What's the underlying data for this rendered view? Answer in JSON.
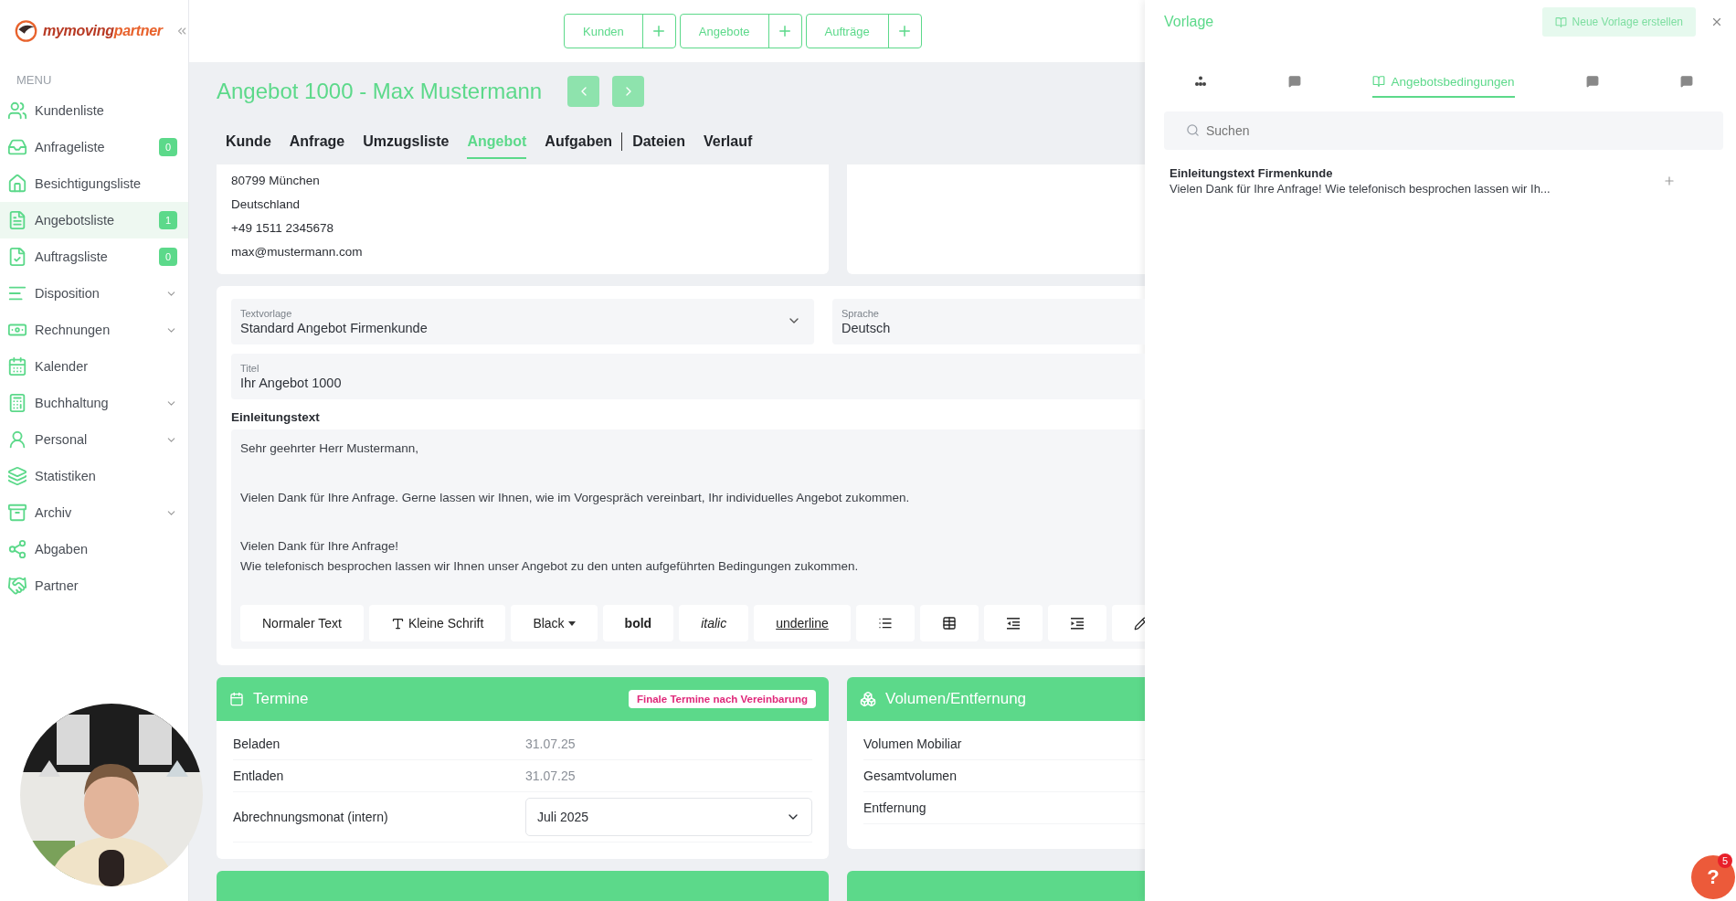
{
  "logo": {
    "text": "mymoving",
    "accent": "partner"
  },
  "sidebar": {
    "heading": "MENU",
    "items": [
      {
        "label": "Kundenliste",
        "selected": false,
        "expandable": false
      },
      {
        "label": "Anfrageliste",
        "selected": false,
        "expandable": false,
        "badge": "0"
      },
      {
        "label": "Besichtigungsliste",
        "selected": false,
        "expandable": false
      },
      {
        "label": "Angebotsliste",
        "selected": true,
        "expandable": false,
        "badge": "1"
      },
      {
        "label": "Auftragsliste",
        "selected": false,
        "expandable": false,
        "badge": "0"
      },
      {
        "label": "Disposition",
        "selected": false,
        "expandable": true
      },
      {
        "label": "Rechnungen",
        "selected": false,
        "expandable": true
      },
      {
        "label": "Kalender",
        "selected": false,
        "expandable": false
      },
      {
        "label": "Buchhaltung",
        "selected": false,
        "expandable": true
      },
      {
        "label": "Personal",
        "selected": false,
        "expandable": true
      },
      {
        "label": "Statistiken",
        "selected": false,
        "expandable": false
      },
      {
        "label": "Archiv",
        "selected": false,
        "expandable": true
      },
      {
        "label": "Abgaben",
        "selected": false,
        "expandable": false
      },
      {
        "label": "Partner",
        "selected": false,
        "expandable": false
      }
    ]
  },
  "header": {
    "quick_buttons": [
      "Kunden",
      "Angebote",
      "Aufträge"
    ]
  },
  "page": {
    "title": "Angebot 1000 - Max Mustermann",
    "tabs": [
      {
        "label": "Kunde",
        "selected": false,
        "divider_after": false
      },
      {
        "label": "Anfrage",
        "selected": false,
        "divider_after": false
      },
      {
        "label": "Umzugsliste",
        "selected": false,
        "divider_after": false
      },
      {
        "label": "Angebot",
        "selected": true,
        "divider_after": false
      },
      {
        "label": "Aufgaben",
        "selected": false,
        "divider_after": true
      },
      {
        "label": "Dateien",
        "selected": false,
        "divider_after": false
      },
      {
        "label": "Verlauf",
        "selected": false,
        "divider_after": false
      }
    ],
    "address_lines": [
      "80799 München",
      "Deutschland",
      "+49 1511 2345678",
      "max@mustermann.com"
    ],
    "template": {
      "textvorlage": {
        "label": "Textvorlage",
        "value": "Standard Angebot Firmenkunde"
      },
      "sprache": {
        "label": "Sprache",
        "value": "Deutsch"
      },
      "titel": {
        "label": "Titel",
        "value": "Ihr Angebot 1000"
      },
      "editor_label": "Einleitungstext",
      "paragraphs": [
        [
          "Sehr geehrter Herr Mustermann,"
        ],
        [
          "Vielen Dank für Ihre Anfrage. Gerne lassen wir Ihnen, wie im Vorgespräch vereinbart, Ihr individuelles Angebot zukommen."
        ],
        [
          "Vielen Dank für Ihre Anfrage!",
          "Wie telefonisch besprochen lassen wir Ihnen unser Angebot zu den unten aufgeführten Bedingungen zukommen."
        ]
      ],
      "toolbar": [
        {
          "kind": "text",
          "label": "Normaler Text"
        },
        {
          "kind": "small",
          "label": "Kleine Schrift"
        },
        {
          "kind": "dropdown",
          "label": "Black"
        },
        {
          "kind": "bold",
          "label": "bold"
        },
        {
          "kind": "italic",
          "label": "italic"
        },
        {
          "kind": "underline",
          "label": "underline"
        },
        {
          "kind": "list"
        },
        {
          "kind": "table"
        },
        {
          "kind": "outdent"
        },
        {
          "kind": "indent"
        },
        {
          "kind": "pen"
        }
      ]
    },
    "termine": {
      "title": "Termine",
      "badge": "Finale Termine nach Vereinbarung",
      "rows": [
        {
          "kind": "text",
          "label": "Beladen",
          "value": "31.07.25"
        },
        {
          "kind": "text",
          "label": "Entladen",
          "value": "31.07.25"
        },
        {
          "kind": "select",
          "label": "Abrechnungsmonat (intern)",
          "value": "Juli 2025"
        }
      ]
    },
    "volumen": {
      "title": "Volumen/Entfernung",
      "rows": [
        "Volumen Mobiliar",
        "Gesamtvolumen",
        "Entfernung"
      ]
    }
  },
  "panel": {
    "title": "Vorlage",
    "create_button": "Neue Vorlage erstellen",
    "tabs": [
      {
        "selected": false
      },
      {
        "selected": false
      },
      {
        "label": "Angebotsbedingungen",
        "selected": true
      },
      {
        "selected": false
      },
      {
        "selected": false
      }
    ],
    "search": {
      "placeholder": "Suchen"
    },
    "items": [
      {
        "title": "Einleitungstext Firmenkunde",
        "text": "Vielen Dank für Ihre Anfrage! Wie telefonisch besprochen lassen wir Ih..."
      }
    ]
  },
  "help": {
    "label": "?",
    "badge": "5"
  }
}
